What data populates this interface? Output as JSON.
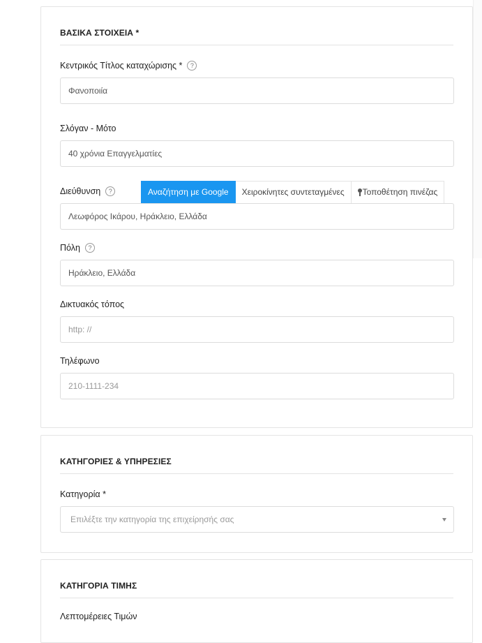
{
  "basic_info": {
    "title": "ΒΑΣΙΚΑ ΣΤΟΙΧΕΙΑ *",
    "listing_title": {
      "label": "Κεντρικός Τίτλος καταχώρισης *",
      "value": "Φανοποιία"
    },
    "slogan": {
      "label": "Σλόγαν - Μότο",
      "value": "40 χρόνια Επαγγελματίες"
    },
    "address": {
      "label": "Διεύθυνση",
      "value": "Λεωφόρος Ικάρου, Ηράκλειο, Ελλάδα",
      "tabs": [
        "Αναζήτηση με Google",
        "Χειροκίνητες συντεταγμένες",
        "Τοποθέτηση πινέζας"
      ]
    },
    "city": {
      "label": "Πόλη",
      "value": "Ηράκλειο, Ελλάδα"
    },
    "website": {
      "label": "Δικτυακός τόπος",
      "placeholder": "http: //"
    },
    "phone": {
      "label": "Τηλέφωνο",
      "placeholder": "210-1111-234"
    }
  },
  "categories": {
    "title": "ΚΑΤΗΓΟΡΙΕΣ & ΥΠΗΡΕΣΙΕΣ",
    "category": {
      "label": "Κατηγορία *",
      "placeholder": "Επιλέξτε την κατηγορία της επιχείρησής σας"
    }
  },
  "price": {
    "title": "ΚΑΤΗΓΟΡΙΑ ΤΙΜΗΣ",
    "details_label": "Λεπτομέρειες Τιμών"
  },
  "help_glyph": "?"
}
